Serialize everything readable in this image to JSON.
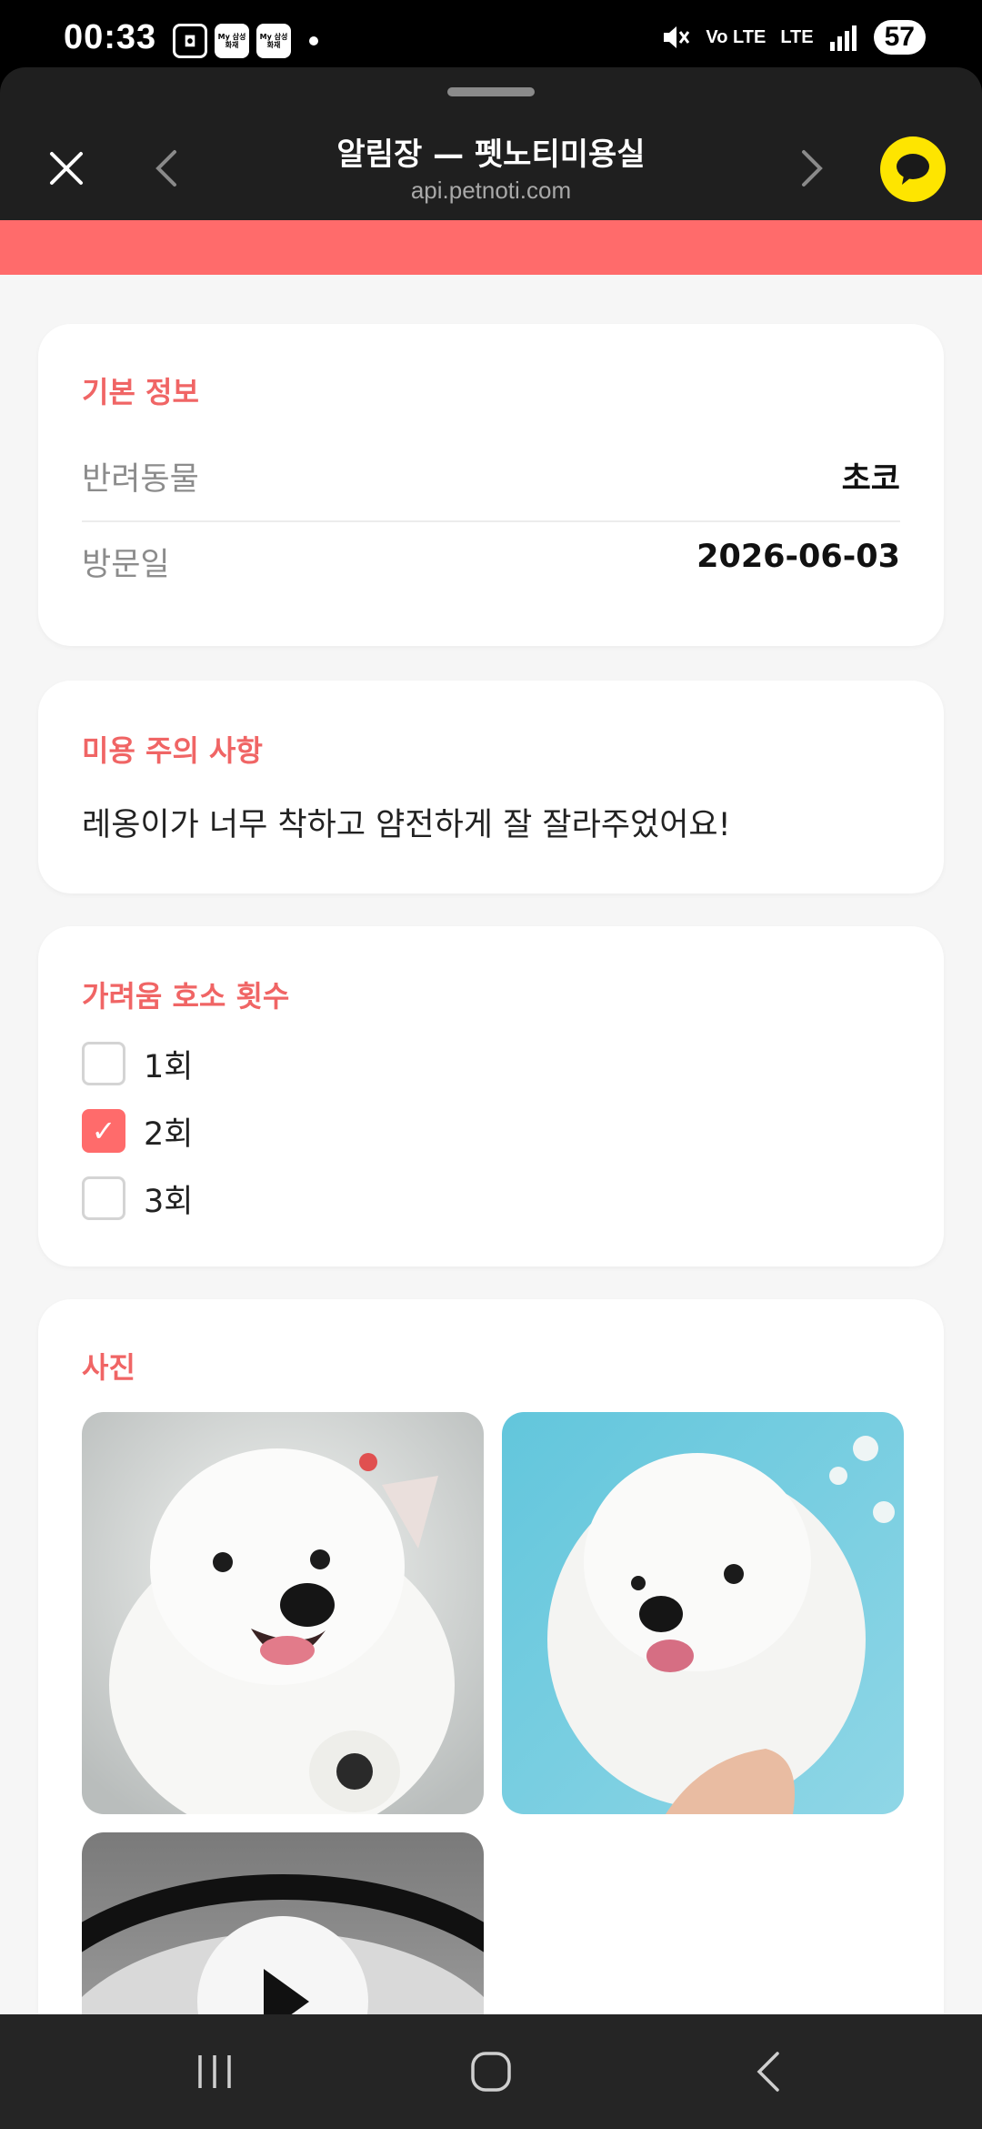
{
  "status_bar": {
    "time": "00:33",
    "app_icon_1_text": "My 삼성화재",
    "app_icon_2_text": "My 삼성화재",
    "network_label": "Vo LTE",
    "lte_label": "LTE",
    "battery": "57"
  },
  "header": {
    "title": "알림장 — 펫노티미용실",
    "url": "api.petnoti.com"
  },
  "basic_info": {
    "title": "기본 정보",
    "rows": [
      {
        "label": "반려동물",
        "value": "초코"
      },
      {
        "label": "방문일",
        "value": "2026-06-03"
      }
    ]
  },
  "grooming_notes": {
    "title": "미용 주의 사항",
    "text": "레옹이가 너무 착하고 얌전하게 잘 잘라주었어요!"
  },
  "itch_count": {
    "title": "가려움 호소 횟수",
    "options": [
      {
        "label": "1회",
        "checked": false
      },
      {
        "label": "2회",
        "checked": true
      },
      {
        "label": "3회",
        "checked": false
      }
    ],
    "check_glyph": "✓"
  },
  "photos": {
    "title": "사진",
    "items": [
      "white-dog-photo",
      "white-poodle-photo",
      "video-thumbnail"
    ]
  },
  "colors": {
    "accent": "#ff6b6b",
    "title_red": "#f06565",
    "kakao_yellow": "#fee500",
    "header_bg": "#1f1f1f"
  }
}
